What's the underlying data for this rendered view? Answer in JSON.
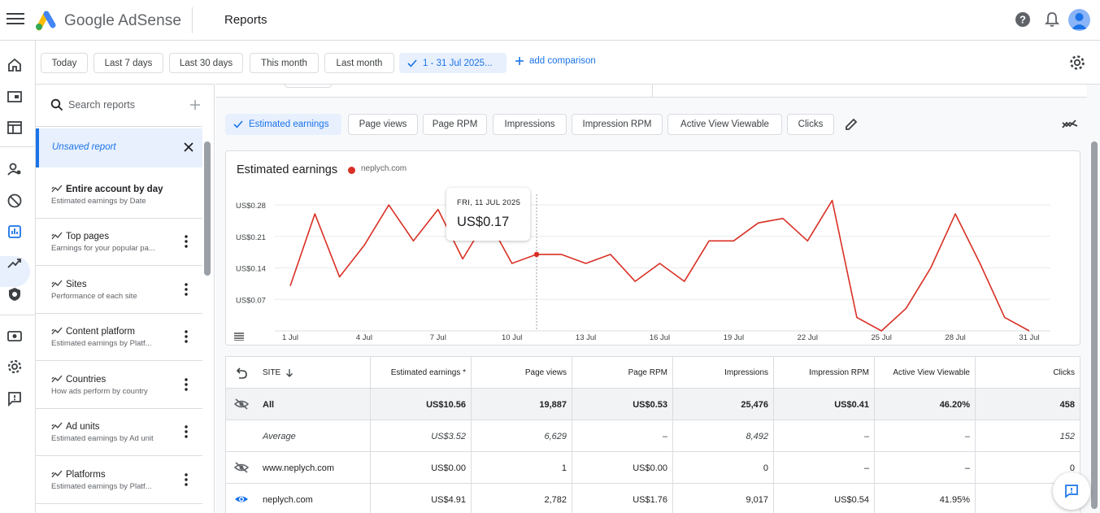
{
  "header": {
    "brand": "Google AdSense",
    "page_title": "Reports"
  },
  "date_range": {
    "chips": [
      "Today",
      "Last 7 days",
      "Last 30 days",
      "This month",
      "Last month"
    ],
    "selected": "1 - 31 Jul 2025...",
    "add_comparison": "add comparison"
  },
  "sidebar": {
    "search_placeholder": "Search reports",
    "unsaved": "Unsaved report",
    "reports": [
      {
        "title": "Entire account by day",
        "subtitle": "Estimated earnings by Date"
      },
      {
        "title": "Top pages",
        "subtitle": "Earnings for your popular pa..."
      },
      {
        "title": "Sites",
        "subtitle": "Performance of each site"
      },
      {
        "title": "Content platform",
        "subtitle": "Estimated earnings by Platf..."
      },
      {
        "title": "Countries",
        "subtitle": "How ads perform by country"
      },
      {
        "title": "Ad units",
        "subtitle": "Estimated earnings by Ad unit"
      },
      {
        "title": "Platforms",
        "subtitle": "Estimated earnings by Platf..."
      }
    ]
  },
  "metrics": {
    "selected": "Estimated earnings",
    "others": [
      "Page views",
      "Page RPM",
      "Impressions",
      "Impression RPM",
      "Active View Viewable",
      "Clicks"
    ]
  },
  "chart": {
    "title": "Estimated earnings",
    "legend": "neplych.com",
    "tooltip_date": "FRI, 11 JUL 2025",
    "tooltip_value": "US$0.17"
  },
  "chart_data": {
    "type": "line",
    "title": "Estimated earnings",
    "x": [
      "1 Jul",
      "2 Jul",
      "3 Jul",
      "4 Jul",
      "5 Jul",
      "6 Jul",
      "7 Jul",
      "8 Jul",
      "9 Jul",
      "10 Jul",
      "11 Jul",
      "12 Jul",
      "13 Jul",
      "14 Jul",
      "15 Jul",
      "16 Jul",
      "17 Jul",
      "18 Jul",
      "19 Jul",
      "20 Jul",
      "21 Jul",
      "22 Jul",
      "23 Jul",
      "24 Jul",
      "25 Jul",
      "26 Jul",
      "27 Jul",
      "28 Jul",
      "29 Jul",
      "30 Jul",
      "31 Jul"
    ],
    "x_tick_labels": [
      "1 Jul",
      "4 Jul",
      "7 Jul",
      "10 Jul",
      "13 Jul",
      "16 Jul",
      "19 Jul",
      "22 Jul",
      "25 Jul",
      "28 Jul",
      "31 Jul"
    ],
    "series": [
      {
        "name": "neplych.com",
        "values": [
          0.1,
          0.26,
          0.12,
          0.19,
          0.28,
          0.2,
          0.27,
          0.16,
          0.25,
          0.15,
          0.17,
          0.17,
          0.15,
          0.17,
          0.11,
          0.15,
          0.11,
          0.2,
          0.2,
          0.24,
          0.25,
          0.2,
          0.29,
          0.03,
          0.0,
          0.05,
          0.14,
          0.26,
          0.15,
          0.03,
          0.0
        ]
      }
    ],
    "y_tick_labels": [
      "US$0.07",
      "US$0.14",
      "US$0.21",
      "US$0.28"
    ],
    "y_ticks": [
      0.07,
      0.14,
      0.21,
      0.28
    ],
    "ylim": [
      0,
      0.28
    ],
    "color": "#d93025",
    "highlight_index": 10
  },
  "table": {
    "headers": [
      "SITE",
      "Estimated earnings *",
      "Page views",
      "Page RPM",
      "Impressions",
      "Impression RPM",
      "Active View Viewable",
      "Clicks"
    ],
    "all": {
      "site": "All",
      "cells": [
        "US$10.56",
        "19,887",
        "US$0.53",
        "25,476",
        "US$0.41",
        "46.20%",
        "458"
      ]
    },
    "average": {
      "site": "Average",
      "cells": [
        "US$3.52",
        "6,629",
        "–",
        "8,492",
        "–",
        "–",
        "152"
      ]
    },
    "rows": [
      {
        "site": "www.neplych.com",
        "cells": [
          "US$0.00",
          "1",
          "US$0.00",
          "0",
          "–",
          "–",
          "0"
        ]
      },
      {
        "site": "neplych.com",
        "cells": [
          "US$4.91",
          "2,782",
          "US$1.76",
          "9,017",
          "US$0.54",
          "41.95%",
          ""
        ]
      }
    ]
  },
  "colors": {
    "accent": "#1a73e8",
    "series": "#d93025"
  }
}
